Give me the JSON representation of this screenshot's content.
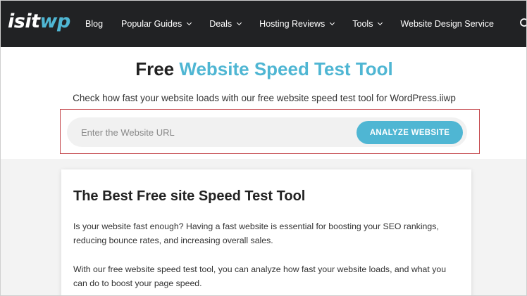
{
  "nav": {
    "logo_part1": "isit",
    "logo_part2": "wp",
    "items": [
      {
        "label": "Blog",
        "dropdown": false
      },
      {
        "label": "Popular Guides",
        "dropdown": true
      },
      {
        "label": "Deals",
        "dropdown": true
      },
      {
        "label": "Hosting Reviews",
        "dropdown": true
      },
      {
        "label": "Tools",
        "dropdown": true
      },
      {
        "label": "Website Design Service",
        "dropdown": false
      }
    ],
    "search_icon": "search-icon"
  },
  "hero": {
    "title_prefix": "Free ",
    "title_accent": "Website Speed Test Tool",
    "subtitle": "Check how fast your website loads with our free website speed test tool for WordPress.iiwp",
    "url_placeholder": "Enter the Website URL",
    "url_value": "",
    "button_label": "ANALYZE WEBSITE"
  },
  "card": {
    "title": "The Best Free site Speed Test Tool",
    "paragraph1": "Is your website fast enough? Having a fast website is essential for boosting your SEO rankings, reducing bounce rates, and increasing overall sales.",
    "paragraph2": "With our free website speed test tool, you can analyze how fast your website loads, and what you can do to boost your page speed."
  },
  "colors": {
    "nav_bg": "#212224",
    "accent": "#4fb6d3",
    "highlight_border": "#c4474c",
    "lower_bg": "#f3f3f3"
  }
}
